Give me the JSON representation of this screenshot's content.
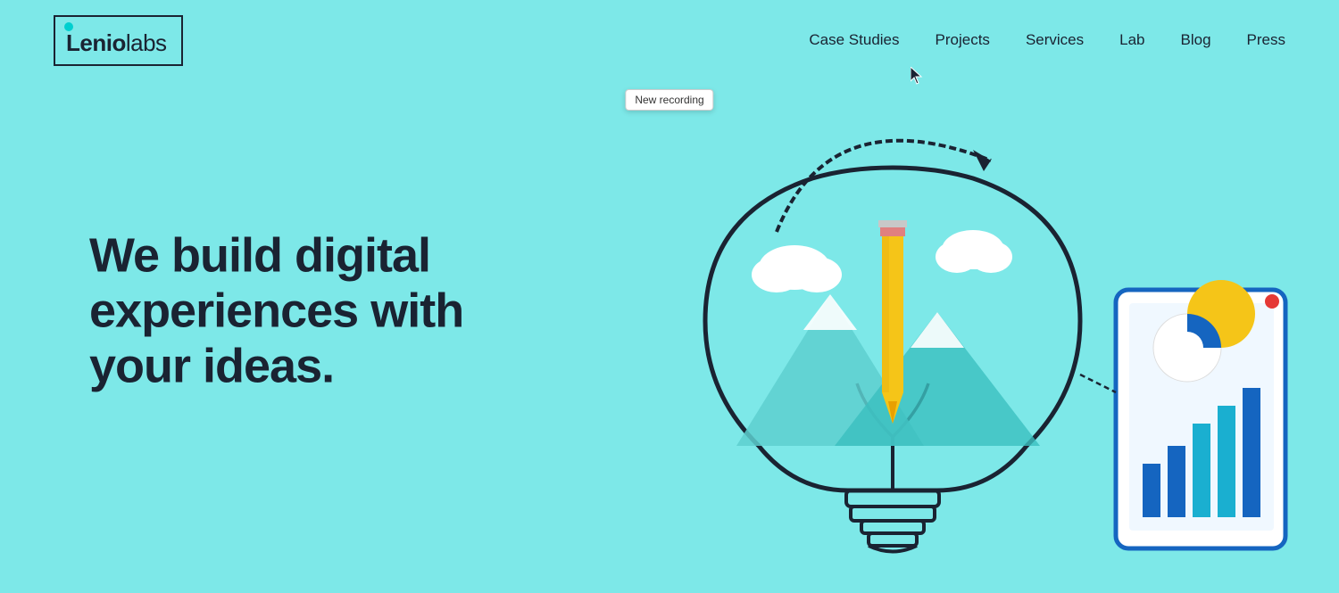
{
  "logo": {
    "text_bold": "Lenio",
    "text_light": "labs"
  },
  "nav": {
    "items": [
      {
        "label": "Case Studies",
        "id": "case-studies"
      },
      {
        "label": "Projects",
        "id": "projects"
      },
      {
        "label": "Services",
        "id": "services"
      },
      {
        "label": "Lab",
        "id": "lab"
      },
      {
        "label": "Blog",
        "id": "blog"
      },
      {
        "label": "Press",
        "id": "press"
      }
    ]
  },
  "tooltip": {
    "text": "New recording"
  },
  "hero": {
    "line1": "We build digital",
    "line2": "experiences with",
    "line3": "your ideas."
  },
  "colors": {
    "bg": "#7de8e8",
    "dark": "#1a2332",
    "accent": "#00cfcf",
    "blue": "#1565c0",
    "yellow": "#f5c518"
  }
}
